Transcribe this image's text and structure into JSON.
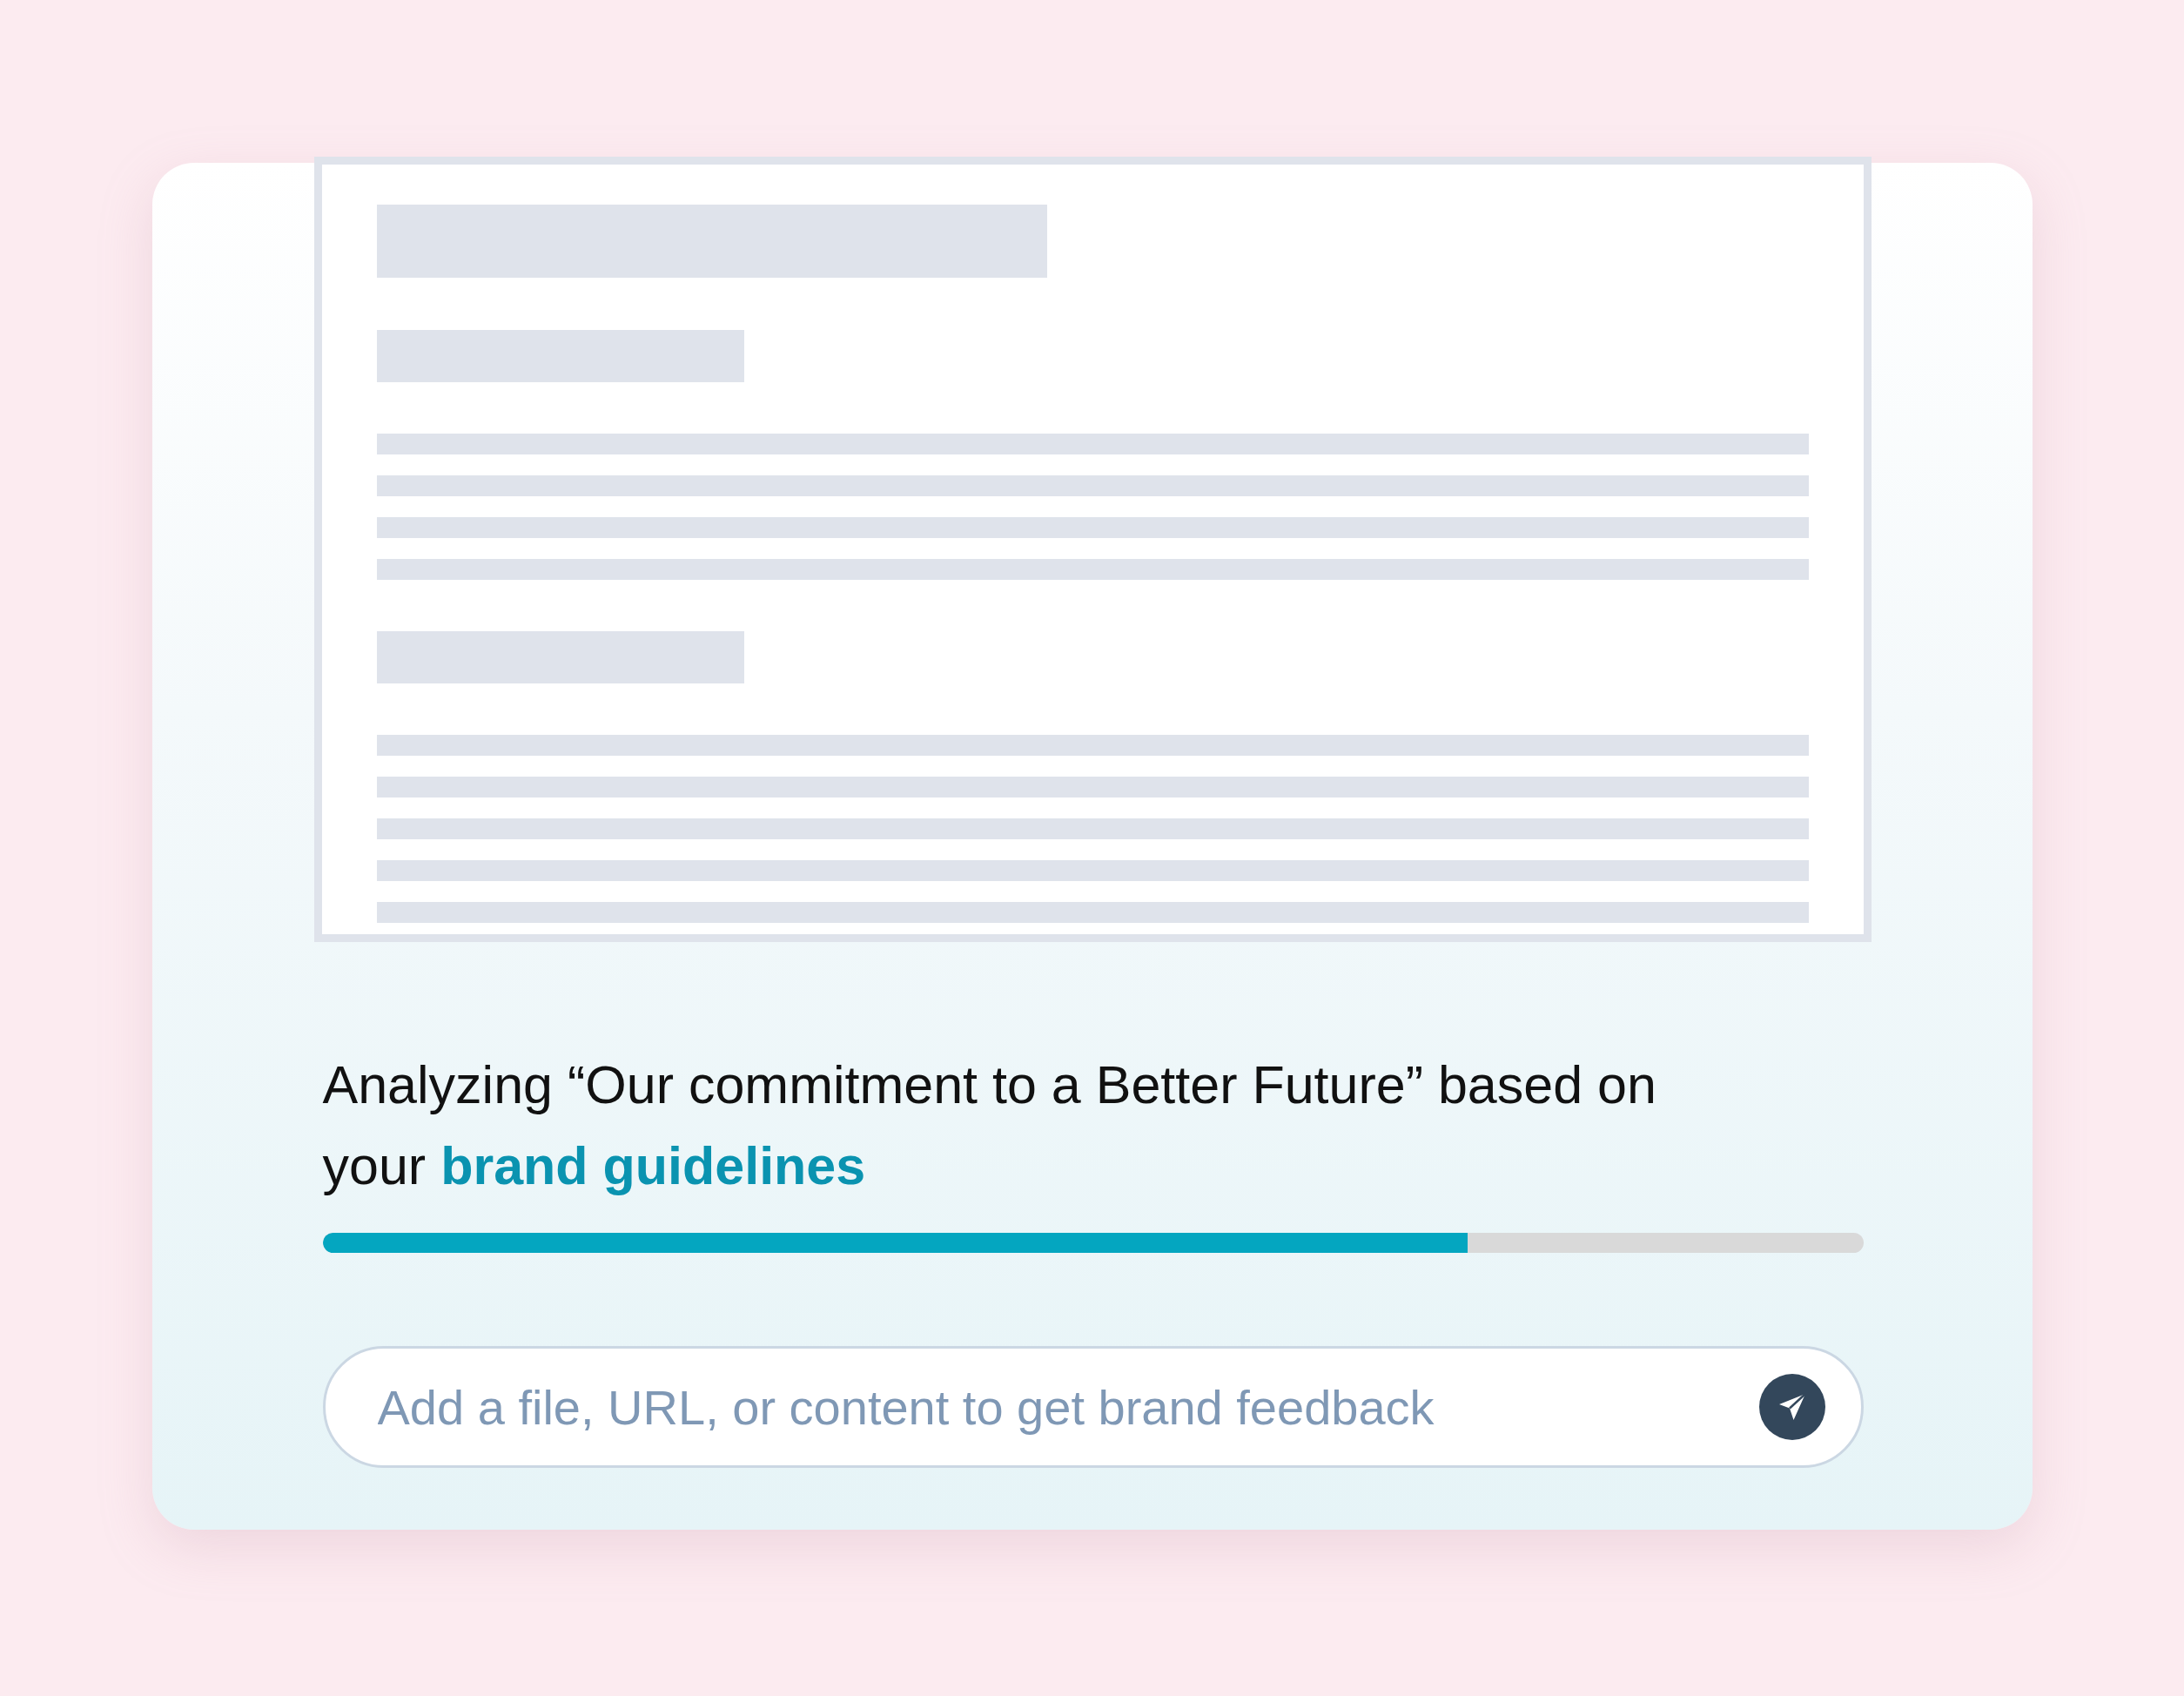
{
  "document_preview": {
    "sections": [
      {
        "kind": "title"
      },
      {
        "kind": "heading"
      },
      {
        "kind": "line"
      },
      {
        "kind": "line"
      },
      {
        "kind": "line"
      },
      {
        "kind": "line"
      },
      {
        "kind": "heading"
      },
      {
        "kind": "line"
      },
      {
        "kind": "line"
      },
      {
        "kind": "line"
      },
      {
        "kind": "line"
      },
      {
        "kind": "line"
      }
    ]
  },
  "status": {
    "message": "Analyzing “Our commitment to a Better Future” based on your **brand guidelines**"
  },
  "progress": {
    "level": 0.743
  },
  "input": {
    "placeholder": "Add a file, URL, or content to get brand feedback"
  }
}
